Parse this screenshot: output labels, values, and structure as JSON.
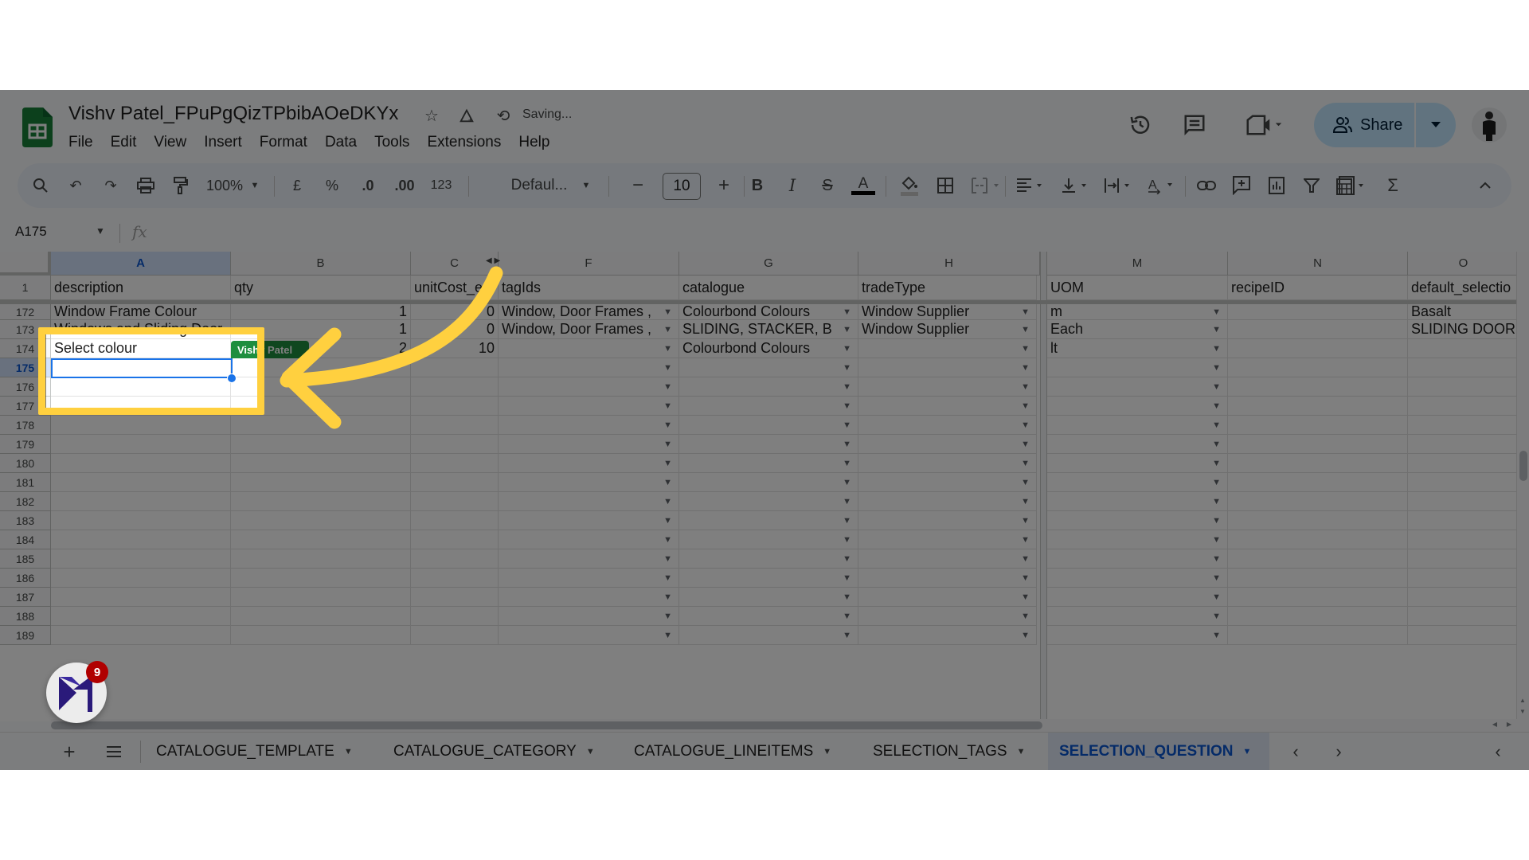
{
  "app": {
    "doc_title": "Vishv Patel_FPuPgQizTPbibAOeDKYx",
    "status": "Saving...",
    "menu": [
      "File",
      "Edit",
      "View",
      "Insert",
      "Format",
      "Data",
      "Tools",
      "Extensions",
      "Help"
    ],
    "share_label": "Share",
    "icons": {
      "logo": "sheets-logo-icon",
      "star": "star-icon",
      "drive": "move-to-drive-icon",
      "sync": "sync-icon",
      "history": "version-history-icon",
      "comments": "comments-icon",
      "meet": "video-call-icon",
      "share": "people-icon",
      "avatar": "user-avatar"
    }
  },
  "toolbar": {
    "zoom": "100%",
    "currency": "£",
    "percent": "%",
    "dec_decrease": ".0",
    "dec_increase": ".00",
    "format_123": "123",
    "font": "Defaul...",
    "font_size": "10",
    "bold": "B",
    "italic": "I",
    "strike": "S",
    "text_color": "A",
    "sum": "Σ"
  },
  "formula_bar": {
    "name_box": "A175",
    "fx_label": "fx",
    "value": ""
  },
  "grid": {
    "columns": [
      {
        "letter": "A",
        "selected": true
      },
      {
        "letter": "B"
      },
      {
        "letter": "C"
      },
      {
        "letter": "F"
      },
      {
        "letter": "G"
      },
      {
        "letter": "H"
      },
      {
        "letter": "M"
      },
      {
        "letter": "N"
      },
      {
        "letter": "O"
      }
    ],
    "header_row": {
      "number": "1",
      "cells": [
        "description",
        "qty",
        "unitCost_e",
        "tagIds",
        "catalogue",
        "tradeType",
        "UOM",
        "recipeID",
        "default_selectio"
      ]
    },
    "rows": [
      {
        "number": "172",
        "cells": [
          "Window Frame Colour",
          "1",
          "0",
          "Window, Door Frames ,",
          "Colourbond Colours",
          "Window Supplier",
          "m",
          "",
          "Basalt"
        ]
      },
      {
        "number": "173",
        "cells": [
          "Windows and Sliding Door",
          "1",
          "0",
          "Window, Door Frames ,",
          "SLIDING, STACKER, B",
          "Window Supplier",
          "Each",
          "",
          "SLIDING DOOR"
        ]
      },
      {
        "number": "174",
        "cells": [
          "Select colour",
          "2",
          "10",
          "",
          "Colourbond Colours",
          "",
          "lt",
          "",
          ""
        ]
      },
      {
        "number": "175",
        "cells": [
          "",
          "",
          "",
          "",
          "",
          "",
          "",
          "",
          ""
        ],
        "selected": true
      },
      {
        "number": "176",
        "cells": [
          "",
          "",
          "",
          "",
          "",
          "",
          "",
          "",
          ""
        ]
      },
      {
        "number": "177",
        "cells": [
          "",
          "",
          "",
          "",
          "",
          "",
          "",
          "",
          ""
        ]
      },
      {
        "number": "178",
        "cells": [
          "",
          "",
          "",
          "",
          "",
          "",
          "",
          "",
          ""
        ]
      },
      {
        "number": "179",
        "cells": [
          "",
          "",
          "",
          "",
          "",
          "",
          "",
          "",
          ""
        ]
      },
      {
        "number": "180",
        "cells": [
          "",
          "",
          "",
          "",
          "",
          "",
          "",
          "",
          ""
        ]
      },
      {
        "number": "181",
        "cells": [
          "",
          "",
          "",
          "",
          "",
          "",
          "",
          "",
          ""
        ]
      },
      {
        "number": "182",
        "cells": [
          "",
          "",
          "",
          "",
          "",
          "",
          "",
          "",
          ""
        ]
      },
      {
        "number": "183",
        "cells": [
          "",
          "",
          "",
          "",
          "",
          "",
          "",
          "",
          ""
        ]
      },
      {
        "number": "184",
        "cells": [
          "",
          "",
          "",
          "",
          "",
          "",
          "",
          "",
          ""
        ]
      },
      {
        "number": "185",
        "cells": [
          "",
          "",
          "",
          "",
          "",
          "",
          "",
          "",
          ""
        ]
      },
      {
        "number": "186",
        "cells": [
          "",
          "",
          "",
          "",
          "",
          "",
          "",
          "",
          ""
        ]
      },
      {
        "number": "187",
        "cells": [
          "",
          "",
          "",
          "",
          "",
          "",
          "",
          "",
          ""
        ]
      },
      {
        "number": "188",
        "cells": [
          "",
          "",
          "",
          "",
          "",
          "",
          "",
          "",
          ""
        ]
      },
      {
        "number": "189",
        "cells": [
          "",
          "",
          "",
          "",
          "",
          "",
          "",
          "",
          ""
        ]
      }
    ],
    "dropdown_columns": [
      "F",
      "G",
      "H",
      "M"
    ],
    "selected_cell": "A175",
    "collaborator_tag": "Vishv Patel"
  },
  "sheet_tabs": {
    "tabs": [
      "CATALOGUE_TEMPLATE",
      "CATALOGUE_CATEGORY",
      "CATALOGUE_LINEITEMS",
      "SELECTION_TAGS",
      "SELECTION_QUESTION"
    ],
    "active": "SELECTION_QUESTION"
  },
  "overlay": {
    "notification_count": "9",
    "highlight_color": "#ffd03f"
  },
  "colors": {
    "accent": "#1a73e8",
    "share_bg": "#c2e7ff",
    "collab_tag": "#1e8e3e",
    "sheets_green": "#188038"
  }
}
